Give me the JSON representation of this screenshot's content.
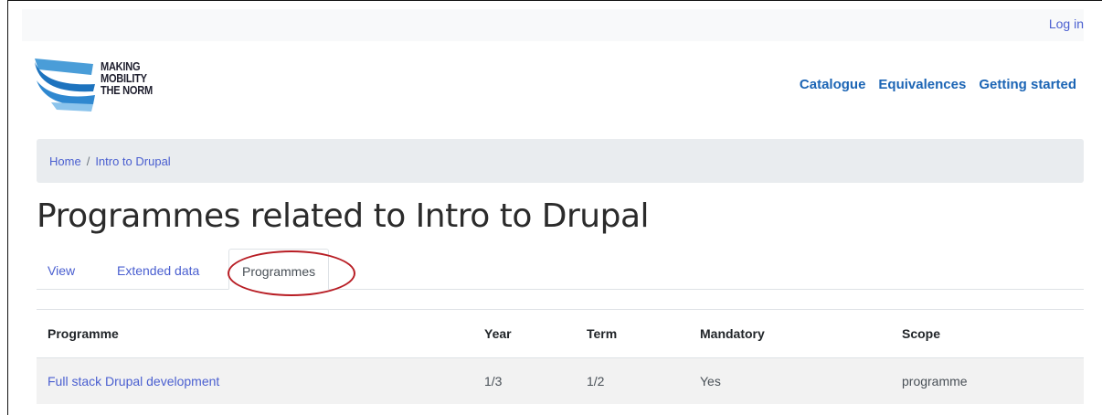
{
  "header": {
    "login_label": "Log in",
    "logo_alt": "Making Mobility the Norm",
    "logo_lines": [
      "MAKING",
      "MOBILITY",
      "THE NORM"
    ],
    "nav": [
      "Catalogue",
      "Equivalences",
      "Getting started"
    ]
  },
  "breadcrumb": {
    "items": [
      "Home",
      "Intro to Drupal"
    ],
    "separator": "/"
  },
  "page": {
    "title": "Programmes related to Intro to Drupal"
  },
  "tabs": [
    {
      "label": "View",
      "active": false
    },
    {
      "label": "Extended data",
      "active": false
    },
    {
      "label": "Programmes",
      "active": true
    }
  ],
  "table": {
    "headers": [
      "Programme",
      "Year",
      "Term",
      "Mandatory",
      "Scope"
    ],
    "rows": [
      [
        "Full stack Drupal development",
        "1/3",
        "1/2",
        "Yes",
        "programme"
      ]
    ]
  },
  "colors": {
    "link": "#4a5fd0",
    "nav_link": "#1c65b5",
    "annotation_circle": "#b81d24",
    "breadcrumb_bg": "#e9ecef"
  }
}
